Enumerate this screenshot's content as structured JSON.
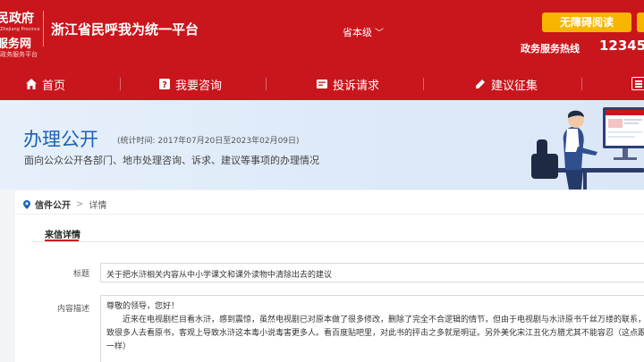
{
  "header": {
    "logo_line1": "民政府",
    "logo_line2": "Zhejiang Province",
    "logo_line3": "服务网",
    "logo_line4": "政务服务平台",
    "platform_title": "浙江省民呼我为统一平台",
    "level_select": "省本级",
    "accessibility_label": "无障碍阅读",
    "hotline_label": "政务服务热线",
    "hotline_number": "12345",
    "brand_color": "#c9161c",
    "accent_color": "#f7b500"
  },
  "nav": {
    "items": [
      {
        "label": "首页",
        "icon": "home-icon"
      },
      {
        "label": "我要咨询",
        "icon": "consult-icon"
      },
      {
        "label": "投诉请求",
        "icon": "complaint-icon"
      },
      {
        "label": "建议征集",
        "icon": "suggestion-icon"
      }
    ]
  },
  "banner": {
    "title": "办理公开",
    "stat_period": "(统计时间: 2017年07月20日至2023年02月09日)",
    "subtitle": "面向公众公开各部门、地市处理咨询、诉求、建议等事项的办理情况"
  },
  "breadcrumb": {
    "first": "信件公开",
    "separator": ">",
    "second": "详情"
  },
  "tab": {
    "label": "来信详情"
  },
  "letter": {
    "title_label": "标题",
    "title_value": "关于把水浒相关内容从中小学课文和课外读物中清除出去的建议",
    "content_label": "内容描述",
    "content_lines": [
      "尊敬的领导，您好！",
      "近来在电视剧栏目看水浒，感到震惊，虽然电视剧已对原本做了很多修改，删除了完全不合逻辑的情节，但由于电视剧与水浒原书千丝万缕的联系，还是",
      "致很多人去看原书，客观上导致水浒这本毒小说毒害更多人。看百度贴吧里，对此书的抨击之多就是明证。另外美化宋江丑化方腊尤其不能容忍（这点跟原书",
      "一样）"
    ]
  }
}
